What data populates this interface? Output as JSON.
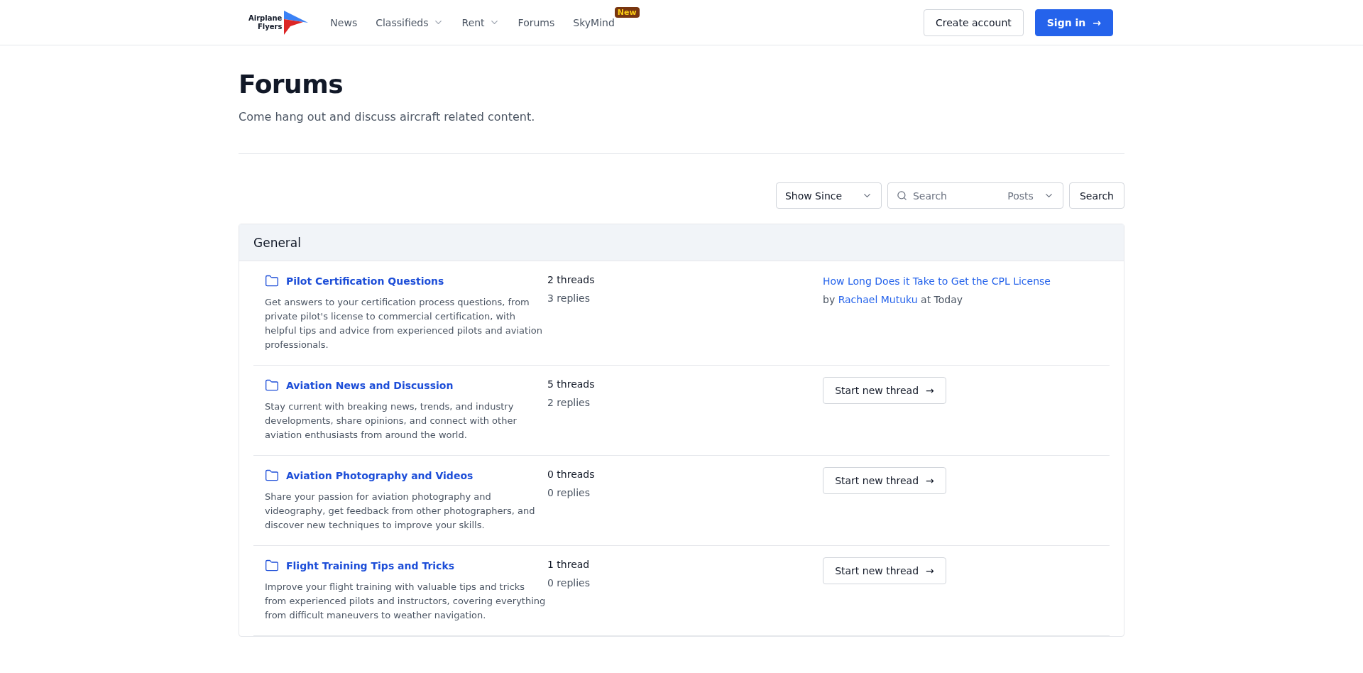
{
  "header": {
    "logo": {
      "line_1": "Airplane",
      "line_2": "Flyers"
    },
    "nav": [
      {
        "label": "News",
        "dropdown": false
      },
      {
        "label": "Classifieds",
        "dropdown": true
      },
      {
        "label": "Rent",
        "dropdown": true
      },
      {
        "label": "Forums",
        "dropdown": false
      },
      {
        "label": "SkyMind",
        "dropdown": false,
        "badge": "New"
      }
    ],
    "create_account": "Create account",
    "sign_in": "Sign in",
    "sign_in_arrow": "→"
  },
  "page": {
    "title": "Forums",
    "subtitle": "Come hang out and discuss aircraft related content."
  },
  "toolbar": {
    "show_since": "Show Since",
    "search": {
      "placeholder": "Search"
    },
    "scope": "Posts",
    "search_button": "Search"
  },
  "section": {
    "title": "General",
    "forums": [
      {
        "kind": "latest",
        "name": "Pilot Certification Questions",
        "description": "Get answers to your certification process questions, from private pilot's license to commercial certification, with helpful tips and advice from experienced pilots and aviation professionals.",
        "threads": "2 threads",
        "replies": "3 replies",
        "latest_title": "How Long Does it Take to Get the CPL License",
        "by": "by",
        "author": "Rachael Mutuku",
        "when": "at Today"
      },
      {
        "kind": "empty",
        "name": "Aviation News and Discussion",
        "description": "Stay current with breaking news, trends, and industry developments, share opinions, and connect with other aviation enthusiasts from around the world.",
        "threads": "5 threads",
        "replies": "2 replies",
        "button": "Start new thread",
        "arrow": "→"
      },
      {
        "kind": "empty",
        "name": "Aviation Photography and Videos",
        "description": "Share your passion for aviation photography and videography, get feedback from other photographers, and discover new techniques to improve your skills.",
        "threads": "0 threads",
        "replies": "0 replies",
        "button": "Start new thread",
        "arrow": "→"
      },
      {
        "kind": "empty",
        "name": "Flight Training Tips and Tricks",
        "description": "Improve your flight training with valuable tips and tricks from experienced pilots and instructors, covering everything from difficult maneuvers to weather navigation.",
        "threads": "1 thread",
        "replies": "0 replies",
        "button": "Start new thread",
        "arrow": "→"
      }
    ]
  }
}
